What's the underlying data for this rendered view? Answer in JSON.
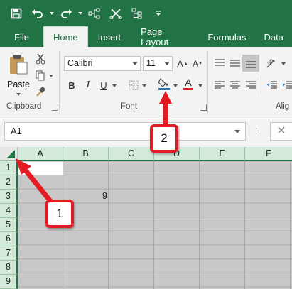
{
  "quick_access": {
    "icons": [
      "save-icon",
      "undo-icon",
      "redo-icon",
      "connector-icon",
      "scissor-tool-icon",
      "org-chart-icon",
      "customize-icon"
    ]
  },
  "tabs": [
    {
      "label": "File"
    },
    {
      "label": "Home"
    },
    {
      "label": "Insert"
    },
    {
      "label": "Page Layout"
    },
    {
      "label": "Formulas"
    },
    {
      "label": "Data"
    }
  ],
  "ribbon": {
    "clipboard": {
      "paste_label": "Paste",
      "group_label": "Clipboard"
    },
    "font": {
      "font_name": "Calibri",
      "font_size": "11",
      "group_label": "Font",
      "bold": "B",
      "italic": "I",
      "underline": "U",
      "grow": "A",
      "shrink": "A",
      "font_color": "A"
    },
    "alignment": {
      "group_label": "Alig"
    }
  },
  "formula_bar": {
    "name_box": "A1",
    "dots": "⋮",
    "cancel": "✕"
  },
  "grid": {
    "columns": [
      "A",
      "B",
      "C",
      "D",
      "E",
      "F"
    ],
    "rows": [
      "1",
      "2",
      "3",
      "4",
      "5",
      "6",
      "7",
      "8",
      "9"
    ],
    "cell_b3": "9"
  },
  "callouts": {
    "one": "1",
    "two": "2"
  },
  "colors": {
    "excel_green": "#217346",
    "callout_red": "#e31b23",
    "selection_gray": "#c8c8c8"
  }
}
